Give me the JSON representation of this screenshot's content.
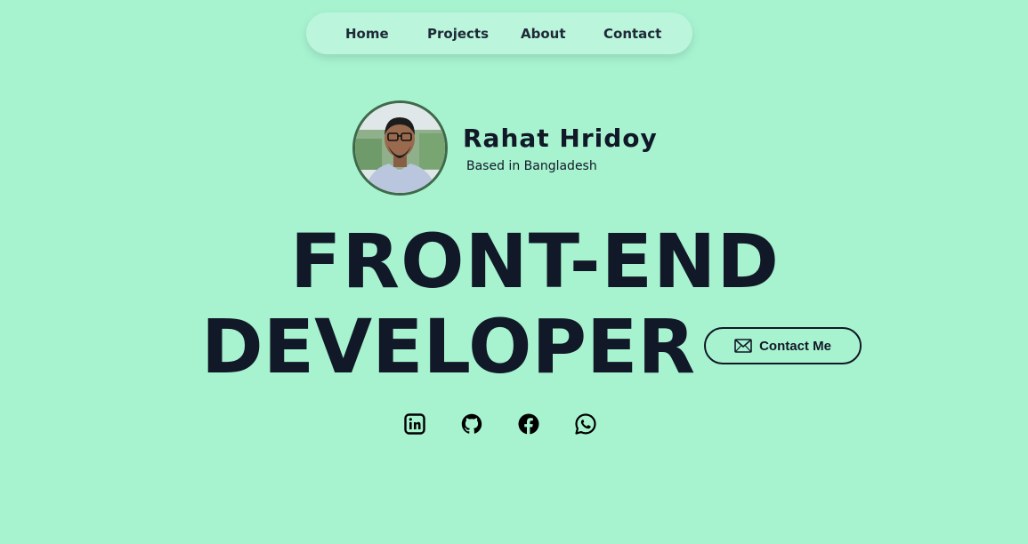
{
  "nav": {
    "items": [
      {
        "label": "Home"
      },
      {
        "label": "Projects"
      },
      {
        "label": "About"
      },
      {
        "label": "Contact"
      }
    ]
  },
  "profile": {
    "name": "Rahat Hridoy",
    "location": "Based in Bangladesh"
  },
  "headline": {
    "line1": "FRONT-END",
    "line2": "DEVELOPER"
  },
  "contact_button": {
    "label": "Contact Me",
    "icon": "envelope-icon"
  },
  "social": [
    {
      "icon": "linkedin-icon"
    },
    {
      "icon": "github-icon"
    },
    {
      "icon": "facebook-icon"
    },
    {
      "icon": "whatsapp-icon"
    }
  ],
  "colors": {
    "background": "#a7f3d0",
    "nav_background": "#baf5dc",
    "text": "#111827",
    "avatar_border": "#3f6a4a"
  }
}
